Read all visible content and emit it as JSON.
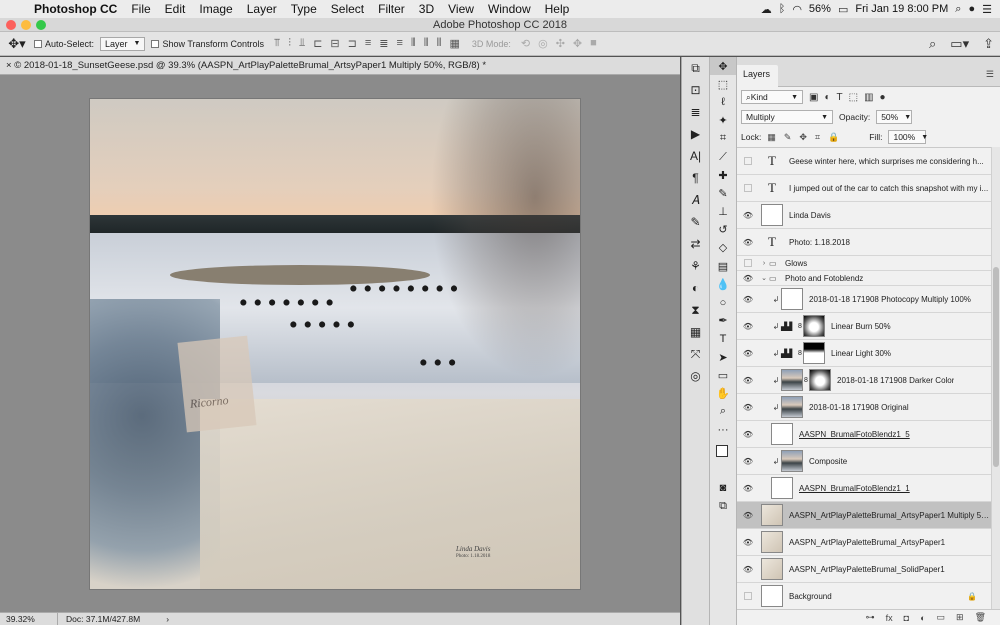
{
  "menubar": {
    "items": [
      "Photoshop CC",
      "File",
      "Edit",
      "Image",
      "Layer",
      "Type",
      "Select",
      "Filter",
      "3D",
      "View",
      "Window",
      "Help"
    ],
    "battery": "56%",
    "clock": "Fri Jan 19  8:00 PM"
  },
  "window": {
    "title": "Adobe Photoshop CC 2018"
  },
  "options": {
    "auto_select_label": "Auto-Select:",
    "auto_select_value": "Layer",
    "transform_label": "Show Transform Controls",
    "mode3d_label": "3D Mode:"
  },
  "document": {
    "tab_title": "© 2018-01-18_SunsetGeese.psd @ 39.3% (AASPN_ArtPlayPaletteBrumal_ArtsyPaper1 Multiply 50%, RGB/8) *",
    "signature_name": "Linda Davis",
    "signature_photo": "Photo: 1.18.2018",
    "ticket_text": "Ricorno"
  },
  "status": {
    "zoom": "39.32%",
    "doc": "Doc: 37.1M/427.8M",
    "chevron": "›"
  },
  "layers_panel": {
    "tab": "Layers",
    "filter_kind": "Kind",
    "blend_mode": "Multiply",
    "opacity_label": "Opacity:",
    "opacity_value": "50%",
    "lock_label": "Lock:",
    "fill_label": "Fill:",
    "fill_value": "100%",
    "layers": [
      {
        "name": "Geese winter here,     which surprises me considering h...",
        "kind": "text",
        "visible": false
      },
      {
        "name": "I jumped out of the car to catch this snapshot with my i...",
        "kind": "text",
        "visible": false
      },
      {
        "name": "Linda Davis",
        "kind": "pixel",
        "visible": true
      },
      {
        "name": "Photo: 1.18.2018",
        "kind": "text",
        "visible": true
      },
      {
        "name": "Glows",
        "kind": "group-collapsed",
        "visible": false
      },
      {
        "name": "Photo and Fotoblendz",
        "kind": "group-open",
        "visible": true
      },
      {
        "name": "2018-01-18 171908 Photocopy Multiply 100%",
        "kind": "clip-pixel",
        "visible": true
      },
      {
        "name": "Linear Burn 50%",
        "kind": "clip-adjust",
        "visible": true
      },
      {
        "name": "Linear Light 30%",
        "kind": "clip-adjust",
        "visible": true
      },
      {
        "name": "2018-01-18 171908 Darker Color",
        "kind": "clip-photo-mask",
        "visible": true
      },
      {
        "name": "2018-01-18 171908 Original",
        "kind": "clip-photo",
        "visible": true
      },
      {
        "name": "AASPN_BrumalFotoBlendz1_5",
        "kind": "pixel-u",
        "visible": true
      },
      {
        "name": "Composite",
        "kind": "clip-photo",
        "visible": true
      },
      {
        "name": "AASPN_BrumalFotoBlendz1_1",
        "kind": "pixel-u",
        "visible": true
      },
      {
        "name": "AASPN_ArtPlayPaletteBrumal_ArtsyPaper1 Multiply 50%",
        "kind": "texture",
        "visible": true,
        "selected": true
      },
      {
        "name": "AASPN_ArtPlayPaletteBrumal_ArtsyPaper1",
        "kind": "texture",
        "visible": true
      },
      {
        "name": "AASPN_ArtPlayPaletteBrumal_SolidPaper1",
        "kind": "texture",
        "visible": true
      },
      {
        "name": "Background",
        "kind": "background",
        "visible": false
      }
    ]
  }
}
